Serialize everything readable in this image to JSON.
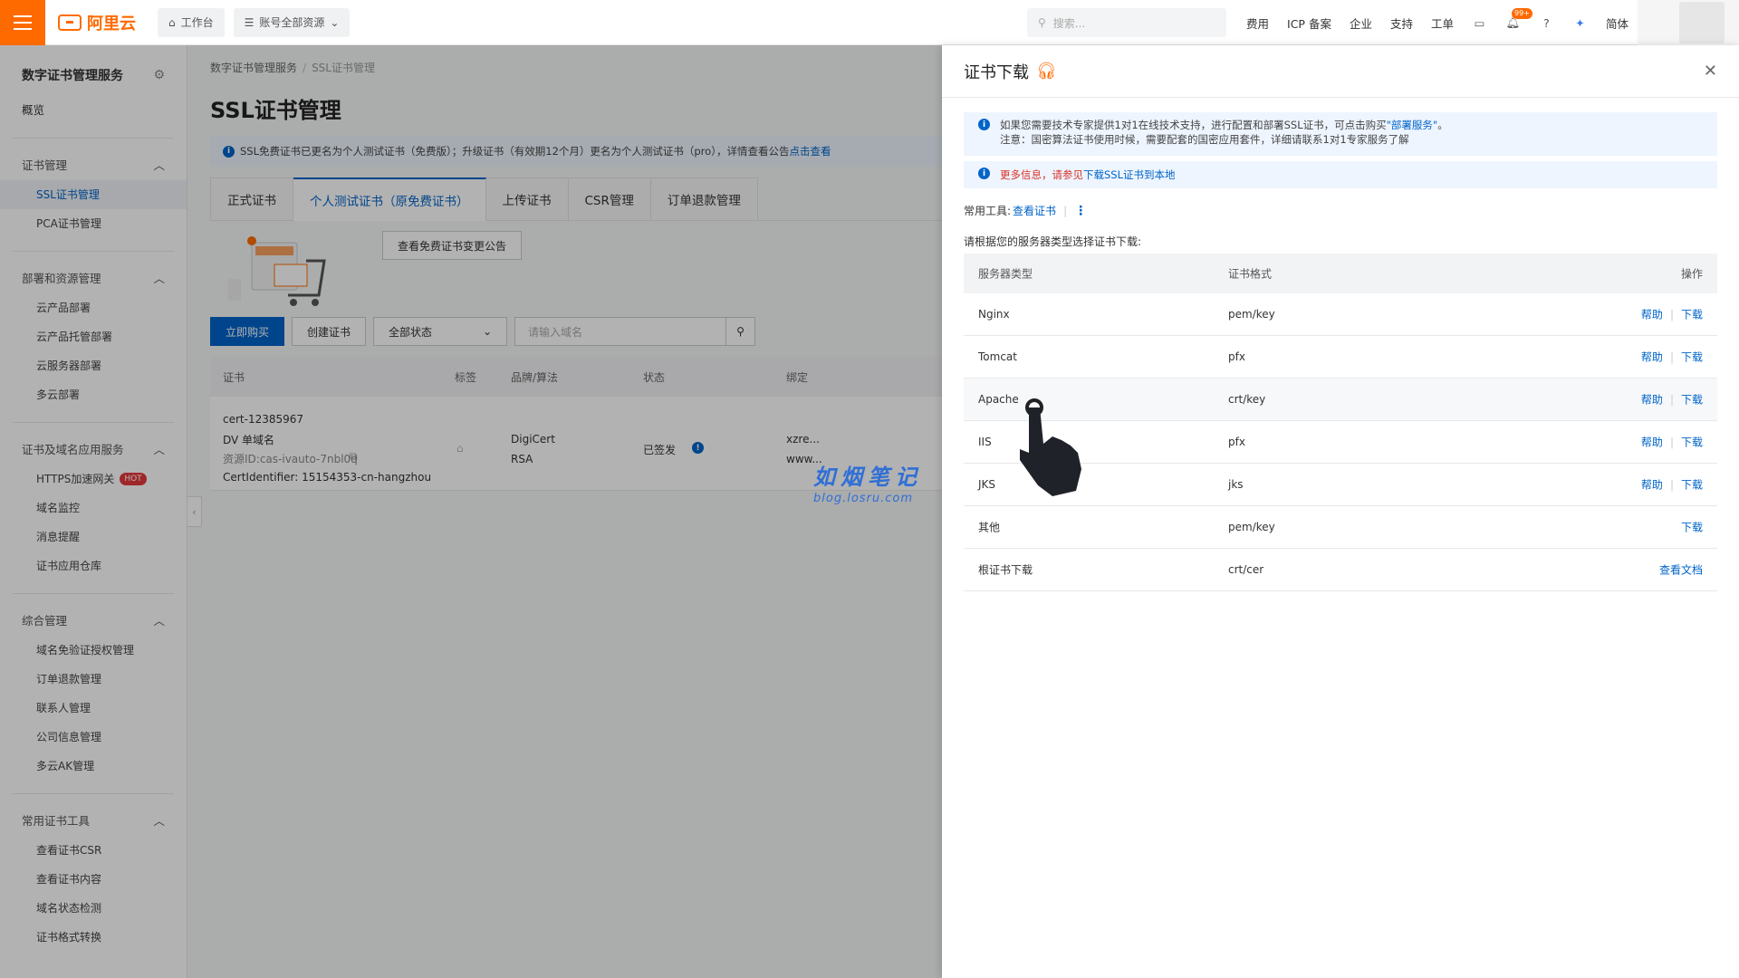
{
  "topbar": {
    "logo_text": "阿里云",
    "workbench": "工作台",
    "resources": "账号全部资源",
    "search_placeholder": "搜索...",
    "nav": [
      "费用",
      "ICP 备案",
      "企业",
      "支持",
      "工单"
    ],
    "notification_badge": "99+",
    "lang": "简体"
  },
  "sidebar": {
    "title": "数字证书管理服务",
    "overview": "概览",
    "groups": [
      {
        "label": "证书管理",
        "items": [
          "SSL证书管理",
          "PCA证书管理"
        ]
      },
      {
        "label": "部署和资源管理",
        "items": [
          "云产品部署",
          "云产品托管部署",
          "云服务器部署",
          "多云部署"
        ]
      },
      {
        "label": "证书及域名应用服务",
        "items": [
          "HTTPS加速网关",
          "域名监控",
          "消息提醒",
          "证书应用仓库"
        ]
      },
      {
        "label": "综合管理",
        "items": [
          "域名免验证授权管理",
          "订单退款管理",
          "联系人管理",
          "公司信息管理",
          "多云AK管理"
        ]
      },
      {
        "label": "常用证书工具",
        "items": [
          "查看证书CSR",
          "查看证书内容",
          "域名状态检测",
          "证书格式转换"
        ]
      }
    ],
    "hot_badge": "HOT"
  },
  "main": {
    "breadcrumb": [
      "数字证书管理服务",
      "SSL证书管理"
    ],
    "title": "SSL证书管理",
    "notice": "SSL免费证书已更名为个人测试证书（免费版）；升级证书（有效期12个月）更名为个人测试证书（pro），详情查看公告",
    "notice_link": "点击查看",
    "tabs": [
      "正式证书",
      "个人测试证书（原免费证书）",
      "上传证书",
      "CSR管理",
      "订单退款管理"
    ],
    "notice_button": "查看免费证书变更公告",
    "buy_button": "立即购买",
    "create_button": "创建证书",
    "status_select": "全部状态",
    "domain_placeholder": "请输入域名",
    "columns": [
      "证书",
      "标签",
      "品牌/算法",
      "状态",
      "绑定"
    ],
    "row": {
      "name": "cert-12385967",
      "type": "DV 单域名",
      "resource_id": "资源ID:cas-ivauto-7nbl0q",
      "identifier": "CertIdentifier: 15154353-cn-hangzhou",
      "brand": "DigiCert",
      "algo": "RSA",
      "status": "已签发",
      "bind1": "xzre...",
      "bind2": "www..."
    }
  },
  "panel": {
    "title": "证书下载",
    "note1_line1": "如果您需要技术专家提供1对1在线技术支持，进行配置和部署SSL证书，可点击购买",
    "note1_link": "\"部署服务\"",
    "note1_end": "。",
    "note1_line2": "注意：国密算法证书使用时候，需要配套的国密应用套件，详细请联系1对1专家服务了解",
    "note2_red": "更多信息，请参见",
    "note2_link": "下载SSL证书到本地",
    "tools_label": "常用工具:",
    "tools_link": "查看证书",
    "hint": "请根据您的服务器类型选择证书下载:",
    "columns": [
      "服务器类型",
      "证书格式",
      "操作"
    ],
    "rows": [
      {
        "server": "Nginx",
        "format": "pem/key",
        "help": "帮助",
        "download": "下载"
      },
      {
        "server": "Tomcat",
        "format": "pfx",
        "help": "帮助",
        "download": "下载"
      },
      {
        "server": "Apache",
        "format": "crt/key",
        "help": "帮助",
        "download": "下载"
      },
      {
        "server": "IIS",
        "format": "pfx",
        "help": "帮助",
        "download": "下载"
      },
      {
        "server": "JKS",
        "format": "jks",
        "help": "帮助",
        "download": "下载"
      },
      {
        "server": "其他",
        "format": "pem/key",
        "download": "下载"
      },
      {
        "server": "根证书下载",
        "format": "crt/cer",
        "doc": "查看文档"
      }
    ]
  },
  "watermark": {
    "title": "如烟笔记",
    "url": "blog.losru.com"
  },
  "colors": {
    "brand": "#ff6a00",
    "link": "#0064c8",
    "danger": "#d93026"
  }
}
